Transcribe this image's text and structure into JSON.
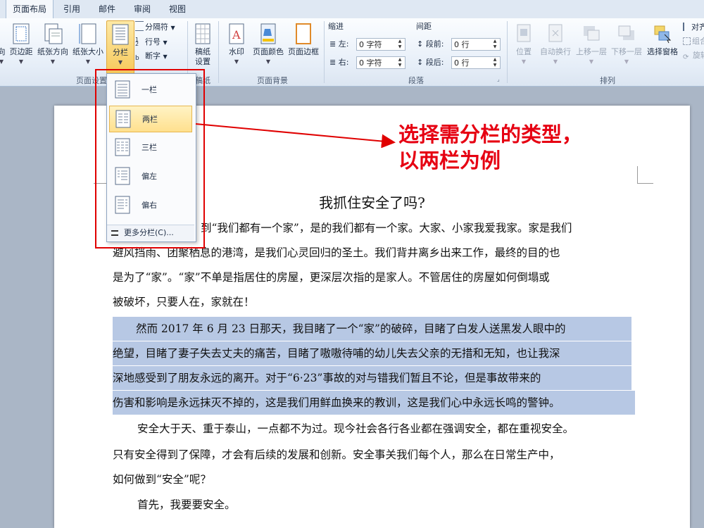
{
  "tabs": [
    "页面布局",
    "引用",
    "邮件",
    "审阅",
    "视图"
  ],
  "active_tab": "页面布局",
  "ribbon": {
    "page_setup": {
      "group_label": "页面设置",
      "buttons": {
        "direction": "向",
        "margins": "页边距",
        "orientation": "纸张方向",
        "size": "纸张大小",
        "columns": "分栏",
        "breaks": "分隔符",
        "line_numbers": "行号",
        "hyphenation": "断字"
      }
    },
    "manuscript": {
      "group_label": "稿纸",
      "button": "稿纸设置",
      "btn_line1": "稿纸",
      "btn_line2": "设置"
    },
    "page_background": {
      "group_label": "页面背景",
      "watermark": "水印",
      "page_color": "页面颜色",
      "page_borders": "页面边框"
    },
    "paragraph": {
      "group_label": "段落",
      "indent_title": "缩进",
      "spacing_title": "间距",
      "left_label": "左:",
      "right_label": "右:",
      "before_label": "段前:",
      "after_label": "段后:",
      "left_value": "0 字符",
      "right_value": "0 字符",
      "before_value": "0 行",
      "after_value": "0 行"
    },
    "arrange": {
      "group_label": "排列",
      "position": "位置",
      "wrap_text": "自动换行",
      "bring_forward": "上移一层",
      "send_backward": "下移一层",
      "selection_pane": "选择窗格",
      "align": "对齐",
      "group": "组合",
      "rotate": "旋转"
    }
  },
  "columns_dropdown": {
    "items": [
      "一栏",
      "两栏",
      "三栏",
      "偏左",
      "偏右"
    ],
    "selected": "两栏",
    "more": "更多分栏(C)..."
  },
  "annotation": {
    "line1": "选择需分栏的类型，",
    "line2": "以两栏为例"
  },
  "document": {
    "title": "我抓住安全了吗?",
    "lines": [
      "到“我们都有一个家”，是的我们都有一个家。大家、小家我爱我家。家是我们",
      "避风挡雨、团聚栖息的港湾，是我们心灵回归的圣土。我们背井离乡出来工作，最终的目的也",
      "是为了“家”。“家”不单是指居住的房屋，更深层次指的是家人。不管居住的房屋如何倒塌或",
      "被破坏，只要人在，家就在！",
      "然而 2017 年 6 月 23 日那天，我目睹了一个“家”的破碎，目睹了白发人送黑发人眼中的",
      "绝望，目睹了妻子失去丈夫的痛苦，目睹了嗷嗷待哺的幼儿失去父亲的无措和无知，也让我深",
      "深地感受到了朋友永远的离开。对于“6·23”事故的对与错我们暂且不论，但是事故带来的",
      "伤害和影响是永远抹灭不掉的，这是我们用鲜血换来的教训，这是我们心中永远长鸣的警钟。",
      "安全大于天、重于泰山，一点都不为过。现今社会各行各业都在强调安全，都在重视安全。",
      "只有安全得到了保障，才会有后续的发展和创新。安全事关我们每个人，那么在日常生产中，",
      "如何做到“安全”呢？",
      "首先，我要要安全。"
    ]
  },
  "watermark": {
    "brand": "Baidu",
    "brand_cn": "经验",
    "url": "jingyan.baidu.com"
  },
  "colors": {
    "accent_red": "#e60012",
    "selection": "#b7c8e4",
    "highlight_gold": "#ffe08e"
  }
}
